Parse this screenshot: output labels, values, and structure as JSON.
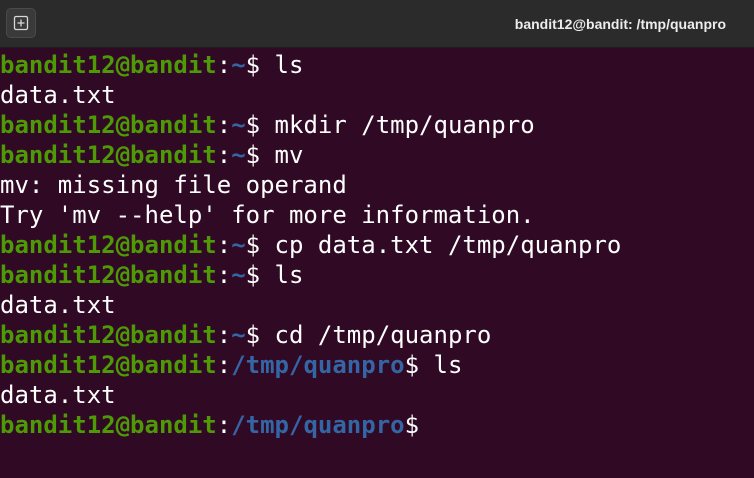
{
  "window": {
    "title": "bandit12@bandit: /tmp/quanpro",
    "new_tab_icon": "new-tab-icon"
  },
  "colors": {
    "background": "#300a24",
    "user_host": "#4e9a06",
    "path": "#3465a4",
    "text": "#ffffff"
  },
  "terminal": {
    "lines": [
      {
        "type": "prompt",
        "user": "bandit12@bandit",
        "colon": ":",
        "path": "~",
        "dollar": "$",
        "cmd": " ls"
      },
      {
        "type": "output",
        "text": "data.txt"
      },
      {
        "type": "prompt",
        "user": "bandit12@bandit",
        "colon": ":",
        "path": "~",
        "dollar": "$",
        "cmd": " mkdir /tmp/quanpro"
      },
      {
        "type": "prompt",
        "user": "bandit12@bandit",
        "colon": ":",
        "path": "~",
        "dollar": "$",
        "cmd": " mv"
      },
      {
        "type": "output",
        "text": "mv: missing file operand"
      },
      {
        "type": "output",
        "text": "Try 'mv --help' for more information."
      },
      {
        "type": "prompt",
        "user": "bandit12@bandit",
        "colon": ":",
        "path": "~",
        "dollar": "$",
        "cmd": " cp data.txt /tmp/quanpro"
      },
      {
        "type": "prompt",
        "user": "bandit12@bandit",
        "colon": ":",
        "path": "~",
        "dollar": "$",
        "cmd": " ls"
      },
      {
        "type": "output",
        "text": "data.txt"
      },
      {
        "type": "prompt",
        "user": "bandit12@bandit",
        "colon": ":",
        "path": "~",
        "dollar": "$",
        "cmd": " cd /tmp/quanpro"
      },
      {
        "type": "prompt",
        "user": "bandit12@bandit",
        "colon": ":",
        "path": "/tmp/quanpro",
        "dollar": "$",
        "cmd": " ls"
      },
      {
        "type": "output",
        "text": "data.txt"
      },
      {
        "type": "prompt",
        "user": "bandit12@bandit",
        "colon": ":",
        "path": "/tmp/quanpro",
        "dollar": "$",
        "cmd": ""
      }
    ]
  }
}
